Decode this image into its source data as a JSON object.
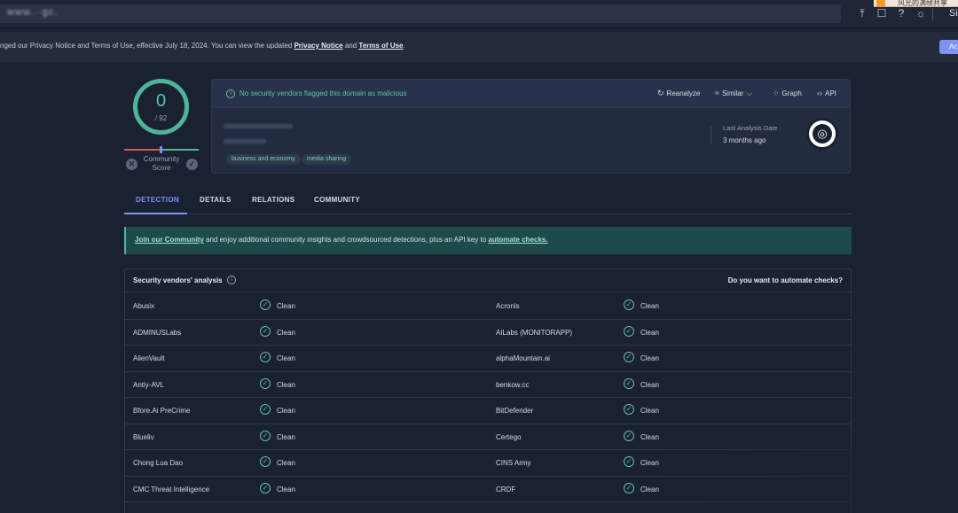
{
  "topbar": {
    "search_value": "www.··gc.",
    "signin_label": "Si",
    "icons": [
      "upload-icon",
      "chat-icon",
      "help-icon",
      "theme-icon"
    ]
  },
  "notice": {
    "text_before": "nged our Privacy Notice and Terms of Use, effective July 18, 2024. You can view the updated ",
    "privacy_link": "Privacy Notice",
    "and": " and ",
    "terms_link": "Terms of Use",
    "after": ".",
    "accept_label": "Ac"
  },
  "overlay": {
    "text": "风光的满帧共享"
  },
  "score": {
    "detections": "0",
    "total": "/ 92",
    "community_label": "Community Score",
    "community_value": 0
  },
  "summary": {
    "flag_text": "No security vendors flagged this domain as malicious",
    "actions": {
      "reanalyze": "Reanalyze",
      "similar": "Similar",
      "graph": "Graph",
      "api": "API"
    },
    "tags": [
      "business and economy",
      "media sharing"
    ],
    "last_analysis_label": "Last Analysis Date",
    "last_analysis_value": "3 months ago"
  },
  "tabs": [
    "DETECTION",
    "DETAILS",
    "RELATIONS",
    "COMMUNITY"
  ],
  "banner": {
    "join_link": "Join our Community",
    "middle": " and enjoy additional community insights and crowdsourced detections, plus an API key to ",
    "automate_link": "automate checks."
  },
  "vendors": {
    "title": "Security vendors' analysis",
    "cta": "Do you want to automate checks?",
    "rows": [
      {
        "left": "Abusix",
        "left_result": "Clean",
        "right": "Acronis",
        "right_result": "Clean"
      },
      {
        "left": "ADMINUSLabs",
        "left_result": "Clean",
        "right": "AILabs (MONITORAPP)",
        "right_result": "Clean"
      },
      {
        "left": "AlienVault",
        "left_result": "Clean",
        "right": "alphaMountain.ai",
        "right_result": "Clean"
      },
      {
        "left": "Antiy-AVL",
        "left_result": "Clean",
        "right": "benkow.cc",
        "right_result": "Clean"
      },
      {
        "left": "Bfore.Ai PreCrime",
        "left_result": "Clean",
        "right": "BitDefender",
        "right_result": "Clean"
      },
      {
        "left": "Blueliv",
        "left_result": "Clean",
        "right": "Certego",
        "right_result": "Clean"
      },
      {
        "left": "Chong Lua Dao",
        "left_result": "Clean",
        "right": "CINS Army",
        "right_result": "Clean"
      },
      {
        "left": "CMC Threat Intelligence",
        "left_result": "Clean",
        "right": "CRDF",
        "right_result": "Clean"
      }
    ]
  }
}
